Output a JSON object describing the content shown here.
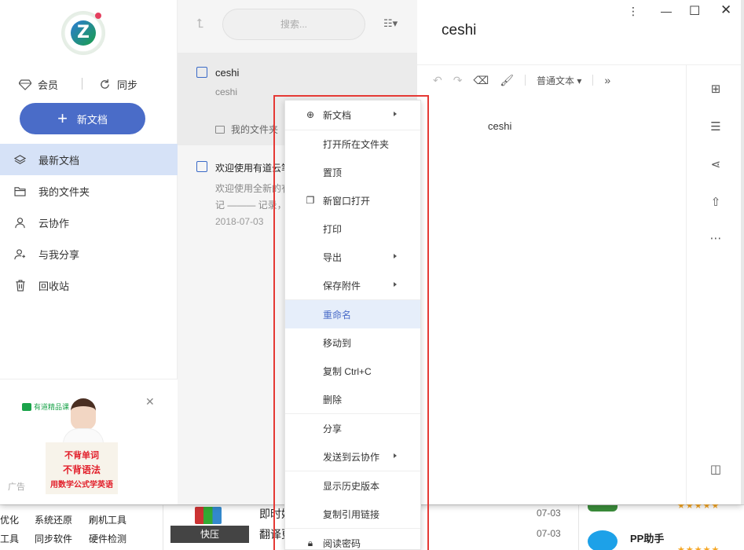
{
  "app": {
    "vip_label": "会员",
    "sync_label": "同步",
    "new_doc_label": "新文档",
    "nav": [
      {
        "label": "最新文档"
      },
      {
        "label": "我的文件夹"
      },
      {
        "label": "云协作"
      },
      {
        "label": "与我分享"
      },
      {
        "label": "回收站"
      }
    ],
    "ad": {
      "brand": "有道精品课",
      "line1": "不背单词",
      "line2": "不背语法",
      "line3": "用数学公式学英语",
      "ad_label": "广告"
    }
  },
  "list": {
    "search_placeholder": "搜索...",
    "docs": [
      {
        "title": "ceshi",
        "snippet": "ceshi",
        "folder": "我的文件夹"
      },
      {
        "title": "欢迎使用有道云笔",
        "snippet1": "欢迎使用全新的有",
        "snippet2": "记 ——— 记录，",
        "date": "2018-07-03"
      }
    ]
  },
  "editor": {
    "title": "ceshi",
    "format_label": "普通文本",
    "more_label": "»",
    "body": "ceshi"
  },
  "context_menu": {
    "items": [
      {
        "label": "新文档",
        "submenu": true,
        "icon": "plus-circle-icon"
      },
      {
        "label": "打开所在文件夹"
      },
      {
        "label": "置顶"
      },
      {
        "label": "新窗口打开",
        "icon": "window-icon"
      },
      {
        "label": "打印"
      },
      {
        "label": "导出",
        "submenu": true
      },
      {
        "label": "保存附件",
        "submenu": true
      },
      {
        "label": "重命名",
        "highlighted": true
      },
      {
        "label": "移动到"
      },
      {
        "label": "复制 Ctrl+C"
      },
      {
        "label": "删除"
      },
      {
        "label": "分享"
      },
      {
        "label": "发送到云协作",
        "submenu": true
      },
      {
        "label": "显示历史版本"
      },
      {
        "label": "复制引用链接"
      },
      {
        "label": "阅读密码",
        "icon": "lock-icon"
      }
    ]
  },
  "background_site": {
    "left_links": [
      [
        "优化",
        "系统还原",
        "刷机工具"
      ],
      [
        "工具",
        "同步软件",
        "硬件检测"
      ]
    ],
    "kuaiya_label": "快压",
    "news": [
      {
        "text": "即时娱乐直播平台",
        "date": "07-03"
      },
      {
        "text": "翻译更有道",
        "date": "07-03"
      }
    ],
    "pp_label": "PP助手"
  },
  "colors": {
    "accent": "#4a6cc8",
    "active_nav": "#d6e2f7",
    "highlight": "#e53935"
  }
}
